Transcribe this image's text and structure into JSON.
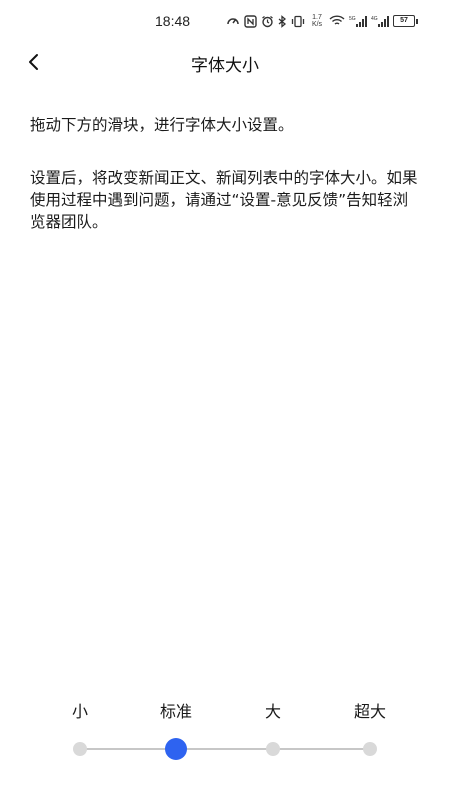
{
  "status_bar": {
    "time": "18:48",
    "speed_value": "1.7",
    "speed_unit": "K/s",
    "signal_1_label": "5G",
    "signal_2_label": "4G",
    "battery": "57",
    "icons": [
      "speed-gauge-icon",
      "nfc-icon",
      "alarm-icon",
      "bluetooth-icon",
      "vibrate-icon",
      "wifi-icon",
      "signal-icon",
      "signal-icon",
      "battery-icon"
    ]
  },
  "header": {
    "title": "字体大小",
    "back_icon": "chevron-left-icon"
  },
  "content": {
    "instruction": "拖动下方的滑块，进行字体大小设置。",
    "description": "设置后，将改变新闻正文、新闻列表中的字体大小。如果使用过程中遇到问题，请通过“设置-意见反馈”告知轻浏览器团队。"
  },
  "font_size_slider": {
    "options": [
      "小",
      "标准",
      "大",
      "超大"
    ],
    "selected": "标准",
    "selected_index": 1,
    "accent_color": "#2e63f0",
    "inactive_color": "#d9d9d9"
  }
}
